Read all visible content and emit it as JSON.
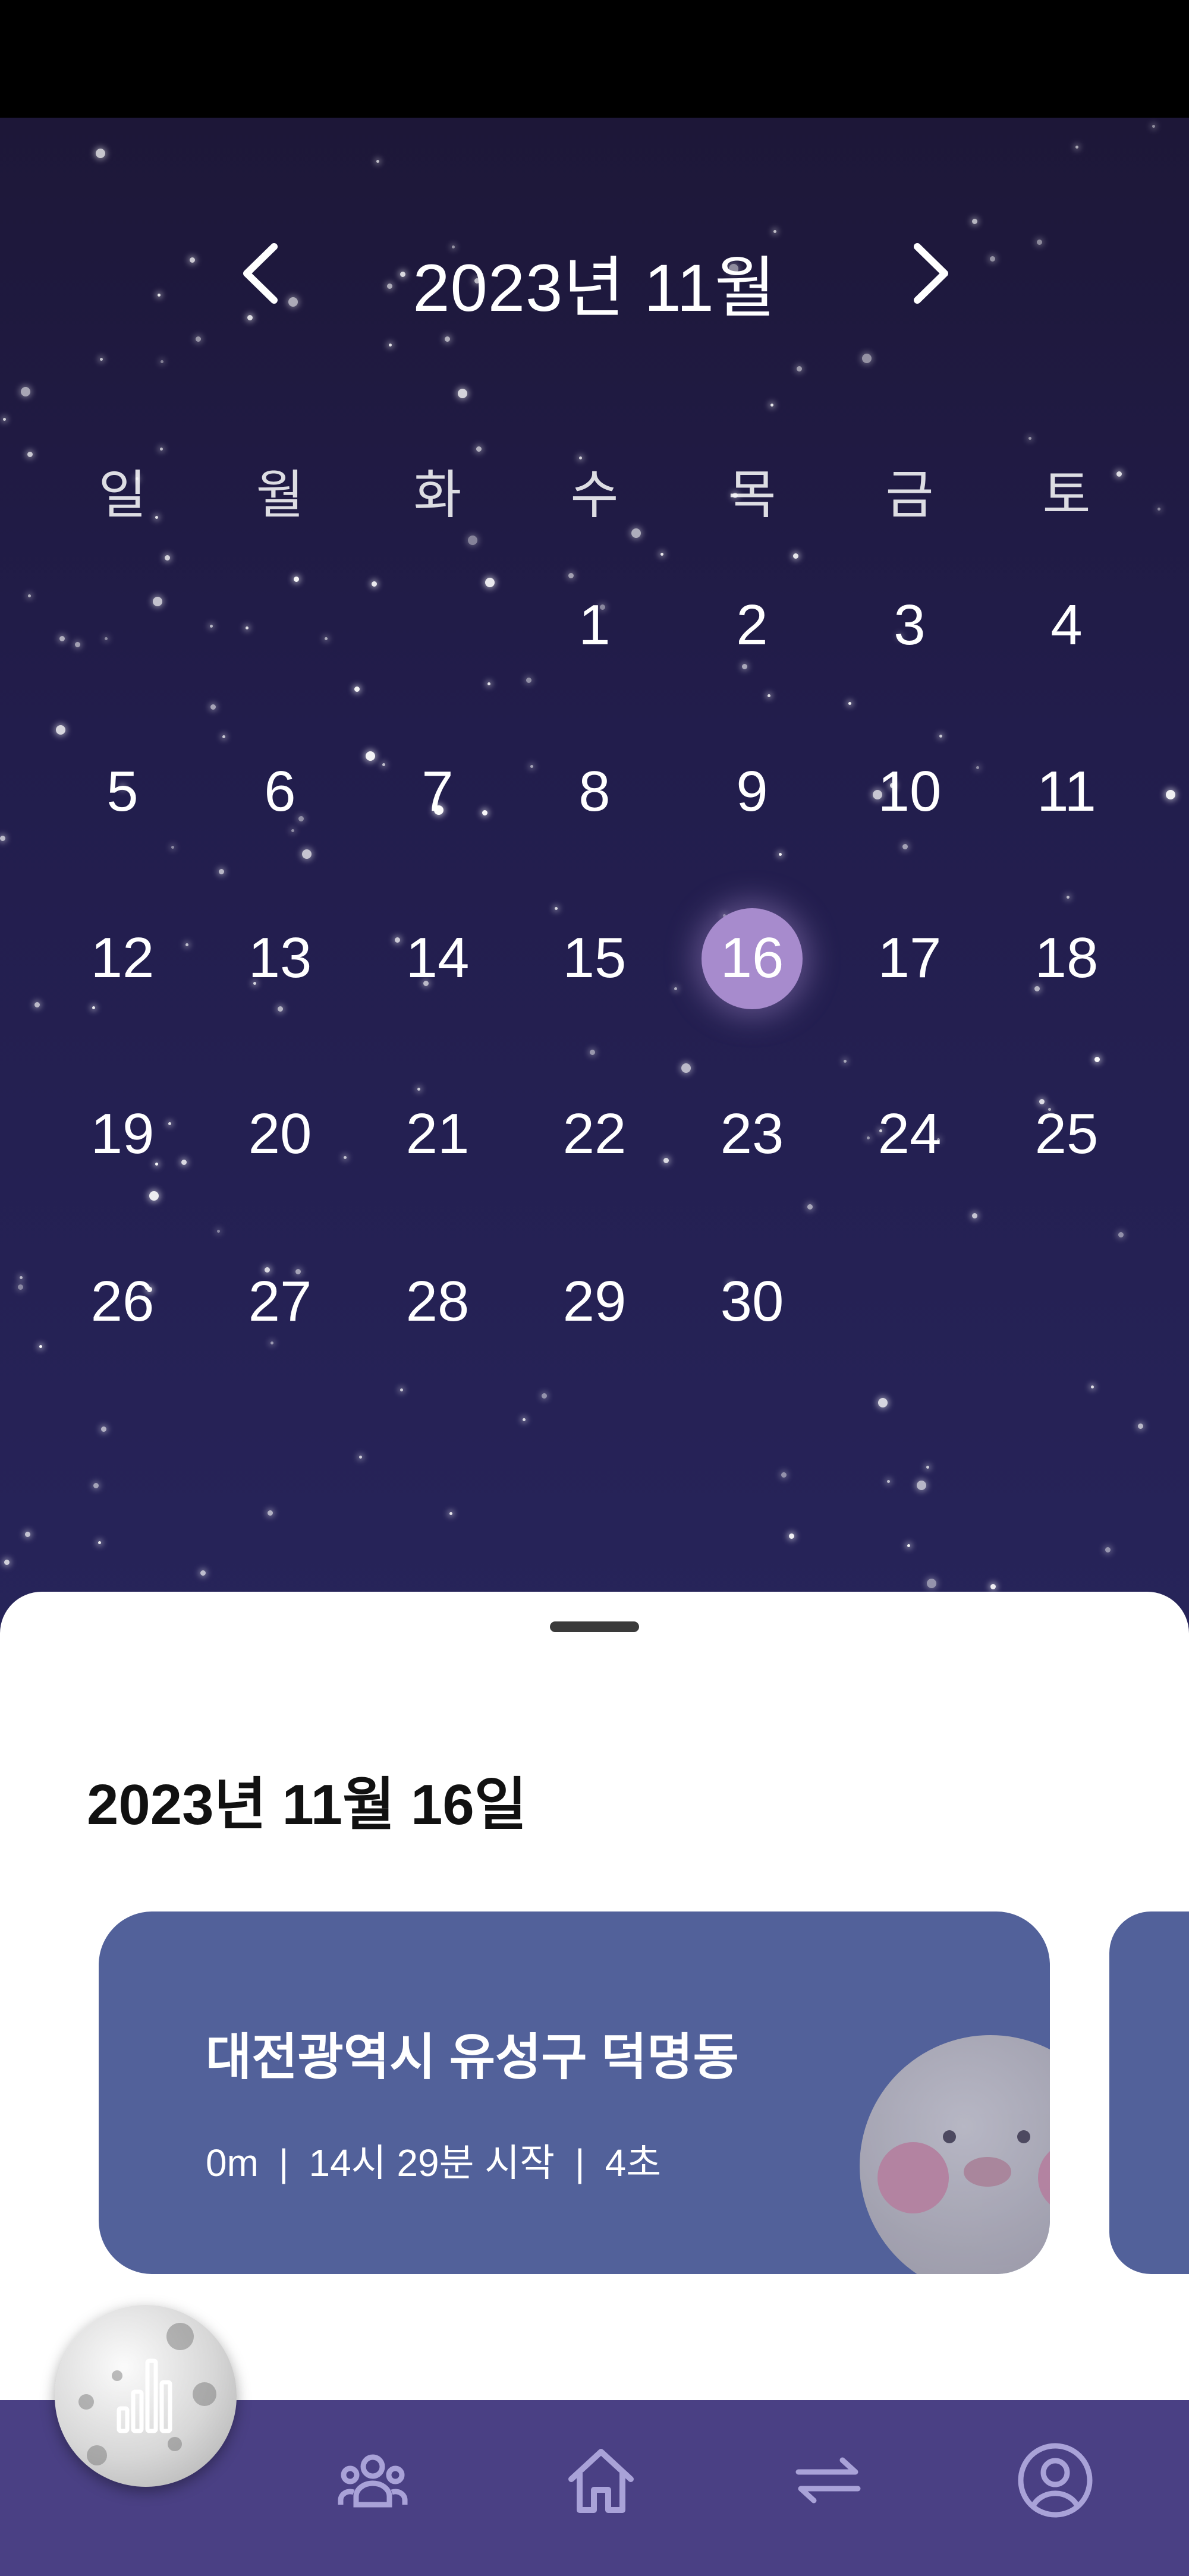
{
  "calendar": {
    "month_title": "2023년 11월",
    "prev_icon": "chevron-left-icon",
    "next_icon": "chevron-right-icon",
    "weekdays": [
      "일",
      "월",
      "화",
      "수",
      "목",
      "금",
      "토"
    ],
    "weeks": [
      [
        "",
        "",
        "",
        "1",
        "2",
        "3",
        "4"
      ],
      [
        "5",
        "6",
        "7",
        "8",
        "9",
        "10",
        "11"
      ],
      [
        "12",
        "13",
        "14",
        "15",
        "16",
        "17",
        "18"
      ],
      [
        "19",
        "20",
        "21",
        "22",
        "23",
        "24",
        "25"
      ],
      [
        "26",
        "27",
        "28",
        "29",
        "30",
        "",
        ""
      ]
    ],
    "selected_day": "16",
    "selected_color": "#a78bcd"
  },
  "sheet": {
    "date_title": "2023년 11월 16일",
    "card": {
      "location": "대전광역시 유성구 덕명동",
      "distance": "0m",
      "start_time": "14시 29분 시작",
      "duration": "4초",
      "separator": "|"
    }
  },
  "bottom_nav": {
    "items": [
      {
        "icon": "friends-icon"
      },
      {
        "icon": "home-icon"
      },
      {
        "icon": "swap-icon"
      },
      {
        "icon": "profile-icon"
      }
    ],
    "fab_icon": "moon-stats-icon"
  },
  "colors": {
    "night_top": "#1d1738",
    "night_bottom": "#27245a",
    "card": "#52619a",
    "nav": "#4a4084"
  }
}
